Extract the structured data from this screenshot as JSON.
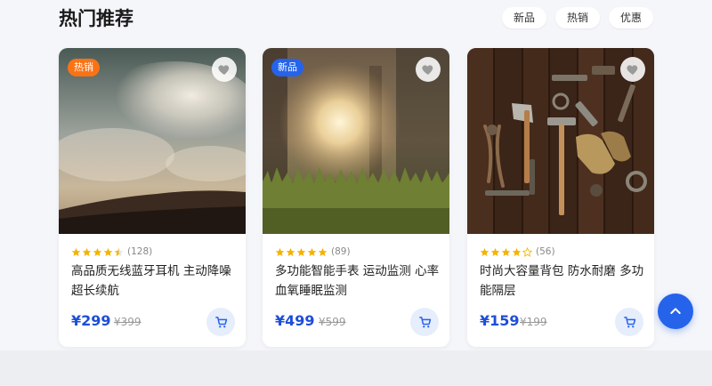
{
  "section": {
    "title": "热门推荐"
  },
  "filters": [
    "新品",
    "热销",
    "优惠"
  ],
  "colors": {
    "accent": "#2563eb",
    "price": "#1d4ed8",
    "badge_hot": "#f97316",
    "badge_new": "#2563eb",
    "star": "#f5b301"
  },
  "products": [
    {
      "badge": "热销",
      "image_subject": "sky-clouds-desert",
      "rating": 4.5,
      "reviews": "(128)",
      "name": "高品质无线蓝牙耳机 主动降噪超长续航",
      "price": "¥299",
      "old_price": "¥399"
    },
    {
      "badge": "新品",
      "image_subject": "sunlight-through-forest-grass",
      "rating": 5,
      "reviews": "(89)",
      "name": "多功能智能手表 运动监测 心率血氧睡眠监测",
      "price": "¥499",
      "old_price": "¥599"
    },
    {
      "badge": "",
      "image_subject": "vintage-tools-on-wood",
      "rating": 4,
      "reviews": "(56)",
      "name": "时尚大容量背包 防水耐磨 多功能隔层",
      "price": "¥159",
      "old_price": "¥199"
    }
  ],
  "icons": {
    "favorite": "heart-icon",
    "cart": "cart-icon",
    "back_to_top": "chevron-up-icon"
  }
}
